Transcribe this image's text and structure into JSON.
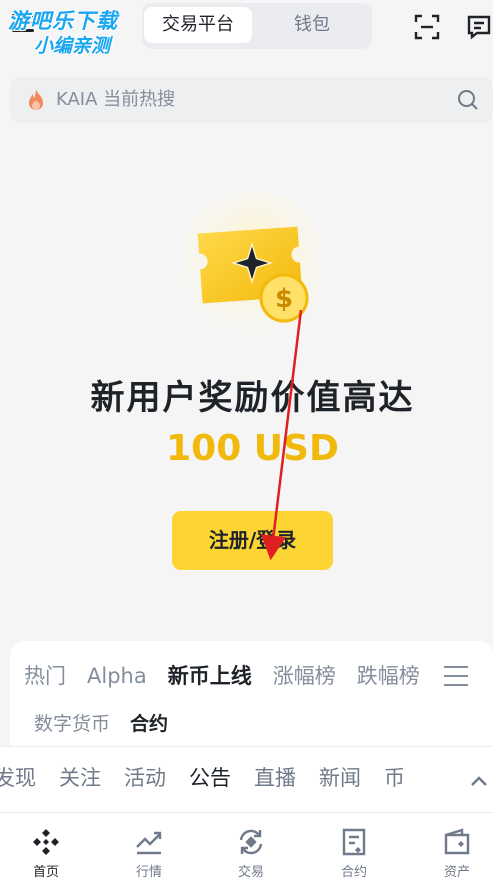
{
  "header": {
    "watermark_line1": "游吧乐下载",
    "watermark_line2": "小编亲测",
    "segment_active": "交易平台",
    "segment_other": "钱包"
  },
  "search": {
    "placeholder": "KAIA 当前热搜"
  },
  "hero": {
    "title": "新用户奖励价值高达",
    "amount": "100 USD",
    "cta_label": "注册/登录"
  },
  "market_tabs": [
    {
      "label": "热门",
      "active": false
    },
    {
      "label": "Alpha",
      "active": false
    },
    {
      "label": "新币上线",
      "active": true
    },
    {
      "label": "涨幅榜",
      "active": false
    },
    {
      "label": "跌幅榜",
      "active": false
    }
  ],
  "market_subtabs": [
    {
      "label": "数字货币",
      "active": false
    },
    {
      "label": "合约",
      "active": true
    }
  ],
  "news_tabs": [
    {
      "label": "发现",
      "active": false
    },
    {
      "label": "关注",
      "active": false
    },
    {
      "label": "活动",
      "active": false
    },
    {
      "label": "公告",
      "active": true
    },
    {
      "label": "直播",
      "active": false
    },
    {
      "label": "新闻",
      "active": false
    },
    {
      "label": "币",
      "active": false
    }
  ],
  "bottom_nav": [
    {
      "label": "首页",
      "icon": "home-diamond-icon",
      "active": true
    },
    {
      "label": "行情",
      "icon": "chart-line-icon",
      "active": false
    },
    {
      "label": "交易",
      "icon": "trade-exchange-icon",
      "active": false
    },
    {
      "label": "合约",
      "icon": "contract-doc-icon",
      "active": false
    },
    {
      "label": "资产",
      "icon": "wallet-icon",
      "active": false
    }
  ],
  "colors": {
    "accent": "#fcd535",
    "gold": "#f0b90b",
    "text": "#1e2329",
    "muted": "#848e9c",
    "annotation": "#e02020"
  }
}
